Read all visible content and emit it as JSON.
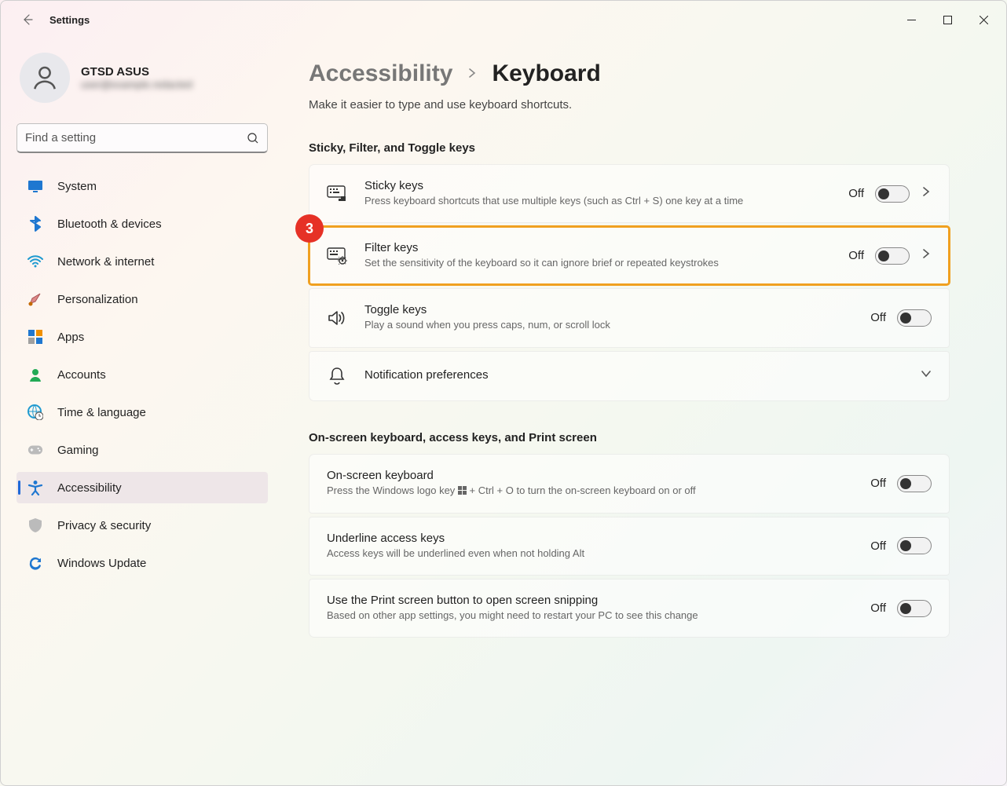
{
  "app": {
    "title": "Settings"
  },
  "profile": {
    "name": "GTSD ASUS",
    "email_masked": "user@example.redacted"
  },
  "search": {
    "placeholder": "Find a setting"
  },
  "sidebar": {
    "items": [
      {
        "label": "System",
        "icon": "monitor",
        "color": "#1f77d0"
      },
      {
        "label": "Bluetooth & devices",
        "icon": "bluetooth",
        "color": "#1f77d0"
      },
      {
        "label": "Network & internet",
        "icon": "wifi",
        "color": "#1f9ad0"
      },
      {
        "label": "Personalization",
        "icon": "brush",
        "color": "#c46a00"
      },
      {
        "label": "Apps",
        "icon": "apps",
        "color": "#1f77d0"
      },
      {
        "label": "Accounts",
        "icon": "person",
        "color": "#22aa55"
      },
      {
        "label": "Time & language",
        "icon": "globe-clock",
        "color": "#1f9ad0"
      },
      {
        "label": "Gaming",
        "icon": "gamepad",
        "color": "#888"
      },
      {
        "label": "Accessibility",
        "icon": "accessibility",
        "color": "#1f77d0",
        "active": true
      },
      {
        "label": "Privacy & security",
        "icon": "shield",
        "color": "#888"
      },
      {
        "label": "Windows Update",
        "icon": "update",
        "color": "#1f77d0"
      }
    ]
  },
  "breadcrumb": {
    "parent": "Accessibility",
    "current": "Keyboard"
  },
  "subtitle": "Make it easier to type and use keyboard shortcuts.",
  "sections": [
    {
      "title": "Sticky, Filter, and Toggle keys",
      "cards": [
        {
          "id": "sticky",
          "title": "Sticky keys",
          "desc": "Press keyboard shortcuts that use multiple keys (such as Ctrl + S) one key at a time",
          "state": "Off",
          "has_chevron": true,
          "icon": "keyboard-pointer"
        },
        {
          "id": "filter",
          "title": "Filter keys",
          "desc": "Set the sensitivity of the keyboard so it can ignore brief or repeated keystrokes",
          "state": "Off",
          "has_chevron": true,
          "highlight": true,
          "step": "3",
          "icon": "keyboard-gear"
        },
        {
          "id": "toggle",
          "title": "Toggle keys",
          "desc": "Play a sound when you press caps, num, or scroll lock",
          "state": "Off",
          "has_chevron": false,
          "icon": "speaker"
        },
        {
          "id": "notif",
          "title": "Notification preferences",
          "desc": "",
          "state": null,
          "has_chevron": "down",
          "icon": "bell"
        }
      ]
    },
    {
      "title": "On-screen keyboard, access keys, and Print screen",
      "cards": [
        {
          "id": "osk",
          "title": "On-screen keyboard",
          "desc_prefix": "Press the Windows logo key ",
          "desc_suffix": " + Ctrl + O to turn the on-screen keyboard on or off",
          "state": "Off",
          "has_chevron": false,
          "icon": null
        },
        {
          "id": "underline",
          "title": "Underline access keys",
          "desc": "Access keys will be underlined even when not holding Alt",
          "state": "Off",
          "has_chevron": false,
          "icon": null
        },
        {
          "id": "printscreen",
          "title": "Use the Print screen button to open screen snipping",
          "desc": "Based on other app settings, you might need to restart your PC to see this change",
          "state": "Off",
          "has_chevron": false,
          "icon": null
        }
      ]
    }
  ]
}
